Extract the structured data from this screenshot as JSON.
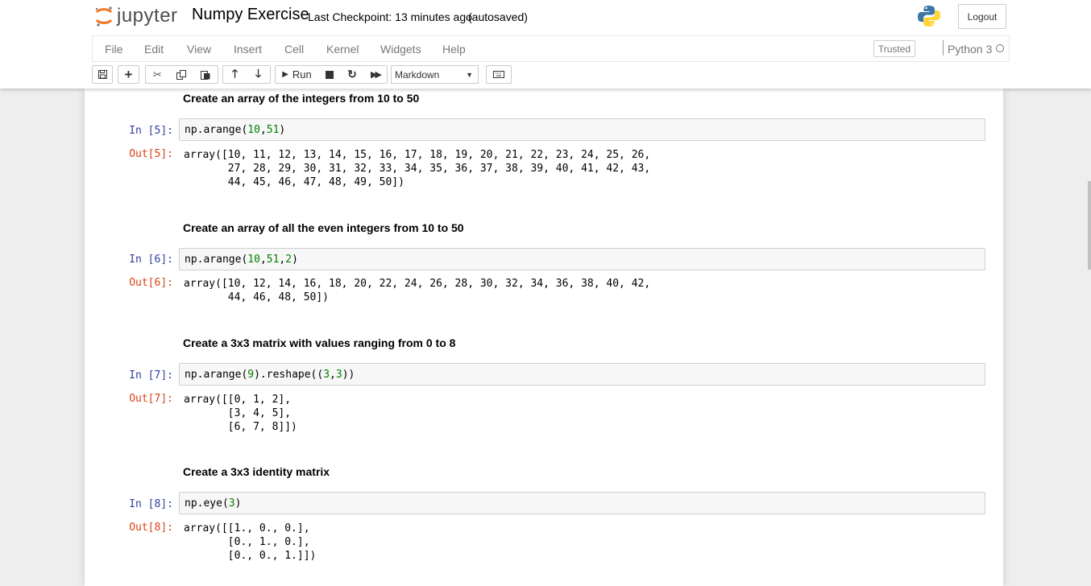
{
  "header": {
    "logo_text": "jupyter",
    "notebook_title": "Numpy Exercise",
    "checkpoint": "Last Checkpoint: 13 minutes ago",
    "autosave": "(autosaved)",
    "logout_label": "Logout"
  },
  "menu": {
    "items": [
      "File",
      "Edit",
      "View",
      "Insert",
      "Cell",
      "Kernel",
      "Widgets",
      "Help"
    ],
    "trusted_label": "Trusted",
    "kernel_name": "Python 3"
  },
  "toolbar": {
    "run_label": "Run",
    "cell_type": "Markdown"
  },
  "cells": [
    {
      "markdown": "Create an array of the integers from 10 to 50",
      "in_prompt": "In [5]:",
      "code": "np.arange(10,51)",
      "out_prompt": "Out[5]:",
      "output": "array([10, 11, 12, 13, 14, 15, 16, 17, 18, 19, 20, 21, 22, 23, 24, 25, 26,\n       27, 28, 29, 30, 31, 32, 33, 34, 35, 36, 37, 38, 39, 40, 41, 42, 43,\n       44, 45, 46, 47, 48, 49, 50])"
    },
    {
      "markdown": "Create an array of all the even integers from 10 to 50",
      "in_prompt": "In [6]:",
      "code": "np.arange(10,51,2)",
      "out_prompt": "Out[6]:",
      "output": "array([10, 12, 14, 16, 18, 20, 22, 24, 26, 28, 30, 32, 34, 36, 38, 40, 42,\n       44, 46, 48, 50])"
    },
    {
      "markdown": "Create a 3x3 matrix with values ranging from 0 to 8",
      "in_prompt": "In [7]:",
      "code": "np.arange(9).reshape((3,3))",
      "out_prompt": "Out[7]:",
      "output": "array([[0, 1, 2],\n       [3, 4, 5],\n       [6, 7, 8]])"
    },
    {
      "markdown": "Create a 3x3 identity matrix",
      "in_prompt": "In [8]:",
      "code": "np.eye(3)",
      "out_prompt": "Out[8]:",
      "output": "array([[1., 0., 0.],\n       [0., 1., 0.],\n       [0., 0., 1.]])"
    }
  ],
  "colors": {
    "in_prompt": "#303f9f",
    "out_prompt": "#d84315",
    "number": "#008000",
    "jupyter_orange": "#f37626"
  }
}
